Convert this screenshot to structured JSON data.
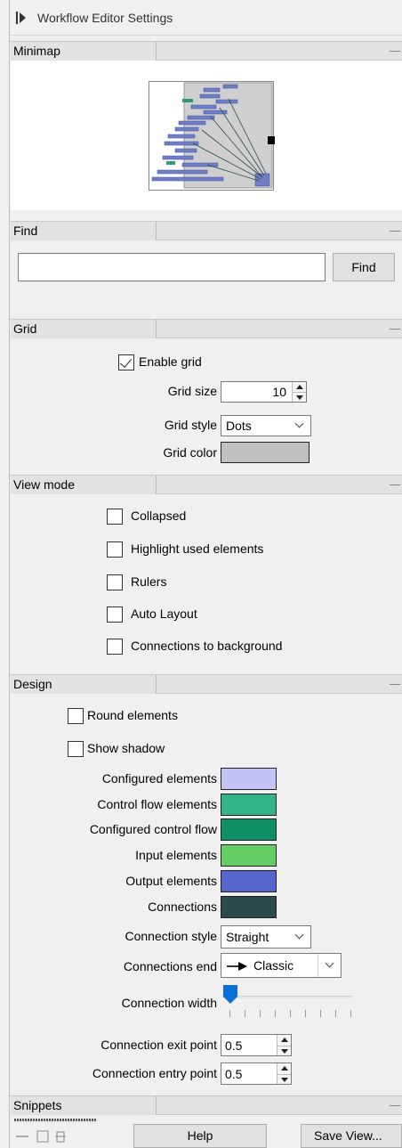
{
  "panel": {
    "title": "Workflow Editor Settings"
  },
  "sections": {
    "minimap": "Minimap",
    "find": "Find",
    "grid": "Grid",
    "view_mode": "View mode",
    "design": "Design",
    "snippets": "Snippets"
  },
  "find": {
    "input_value": "",
    "button_label": "Find"
  },
  "grid": {
    "enable_label": "Enable grid",
    "enable_checked": true,
    "size_label": "Grid size",
    "size_value": "10",
    "style_label": "Grid style",
    "style_value": "Dots",
    "color_label": "Grid color",
    "color": "#c0c0c0"
  },
  "view_mode": {
    "collapsed": "Collapsed",
    "highlight": "Highlight used elements",
    "rulers": "Rulers",
    "auto_layout": "Auto Layout",
    "connections_bg": "Connections to background"
  },
  "design": {
    "round_elements": "Round elements",
    "show_shadow": "Show shadow",
    "colors": [
      {
        "label": "Configured elements",
        "color": "#c3c3f5"
      },
      {
        "label": "Control flow elements",
        "color": "#34b38a"
      },
      {
        "label": "Configured control flow",
        "color": "#0e8f66"
      },
      {
        "label": "Input elements",
        "color": "#66cc66"
      },
      {
        "label": "Output elements",
        "color": "#5566cc"
      },
      {
        "label": "Connections",
        "color": "#2d4a4a"
      }
    ],
    "connection_style_label": "Connection style",
    "connection_style_value": "Straight",
    "connections_end_label": "Connections end",
    "connections_end_value": "Classic",
    "connection_width_label": "Connection width",
    "connection_width_level": 0,
    "exit_point_label": "Connection exit point",
    "exit_point_value": "0.5",
    "entry_point_label": "Connection entry point",
    "entry_point_value": "0.5"
  },
  "footer": {
    "help_label": "Help",
    "save_view_label": "Save View..."
  },
  "icons": [
    "panel-toggle-icon",
    "collapse-dash-icon",
    "chevron-down-icon",
    "spin-up-icon",
    "spin-down-icon",
    "arrow-right-icon",
    "footer-minus-icon",
    "footer-folder-icon",
    "footer-pin-icon"
  ]
}
